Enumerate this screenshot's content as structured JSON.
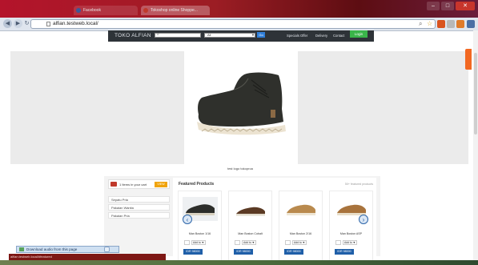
{
  "browser": {
    "tabs": [
      {
        "title": "Facebook",
        "favicon_color": "#3b5998"
      },
      {
        "title": "Tokoshop online Shoppe...",
        "favicon_color": "#c0392b"
      }
    ],
    "address": "alfian.testweb.local/",
    "window_controls": [
      "–",
      "□",
      "✕"
    ]
  },
  "site": {
    "brand": "TOKO ALFIAN",
    "search_placeholder": "",
    "category_select": "All",
    "go_label": "Go",
    "nav_links": [
      "Specials Offer",
      "Delivery",
      "Contact"
    ],
    "login_label": "Login"
  },
  "hero": {
    "caption": "test logo tokoproa"
  },
  "sidebar": {
    "cart_text": "1 Items in your cart",
    "cart_button": "VIEW",
    "categories": [
      "Sepatu Pria",
      "Pakaian Wanita",
      "Pakaian Pria"
    ]
  },
  "featured": {
    "title": "Featured Products",
    "view_all": "50+ featured products",
    "products": [
      {
        "name": "Man Boston 1/16",
        "add_label": "Add to ▼",
        "price": "IDR 98000"
      },
      {
        "name": "Man Boston Cobalt",
        "add_label": "Add to ▼",
        "price": "IDR 98000"
      },
      {
        "name": "Man Boston 2/16",
        "add_label": "Add to ▼",
        "price": "IDR 98000"
      },
      {
        "name": "Man Boston ASP",
        "add_label": "Add to ▼",
        "price": "IDR 98000"
      }
    ],
    "prev_label": "‹",
    "next_label": "›"
  },
  "download_bar": {
    "text": "Download audio from this page"
  },
  "status_url": "alfian.testweb.local/#featured",
  "colors": {
    "titlebar": "#b4142b",
    "site_header": "#2e3338",
    "login": "#3ab54a",
    "cart_button": "#f0a30a",
    "price_button": "#1f5fa8",
    "side_tab": "#f26822"
  }
}
